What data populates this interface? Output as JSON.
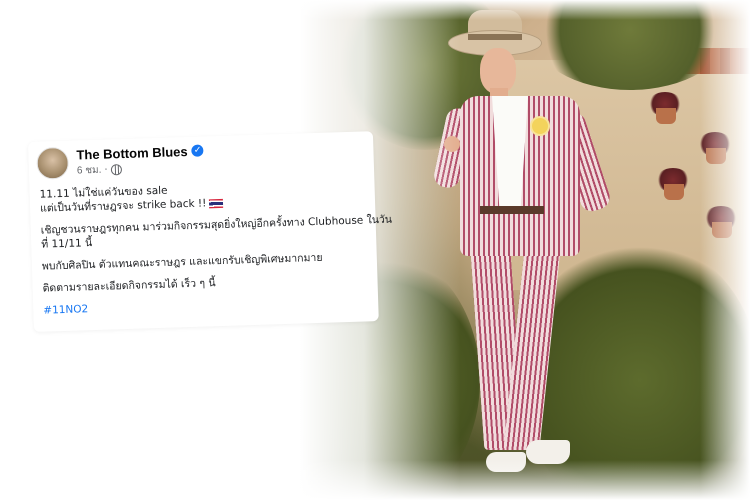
{
  "post": {
    "page_name": "The Bottom Blues",
    "verified": true,
    "timestamp": "6 ชม.",
    "separator": "·",
    "privacy_icon": "globe-icon",
    "paragraphs": [
      [
        "11.11 ไม่ใช่แค่วันของ sale",
        "แต่เป็นวันที่ราษฎรจะ strike back !!"
      ],
      [
        "เชิญชวนราษฎรทุกคน มาร่วมกิจกรรมสุดยิ่งใหญ่อีกครั้งทาง Clubhouse ในวัน",
        "ที่ 11/11 นี้"
      ],
      [
        "พบกับศิลปิน ตัวแทนคณะราษฎร และแขกรับเชิญพิเศษมากมาย"
      ],
      [
        "ติดตามรายละเอียดกิจกรรมได้ เร็ว ๆ นี้"
      ]
    ],
    "flag_emoji": "thailand-flag",
    "hashtag": "#11NO2"
  },
  "colors": {
    "hashtag": "#1877f2",
    "verified_badge": "#1877f2",
    "suit_stripe": "#b14c68"
  }
}
